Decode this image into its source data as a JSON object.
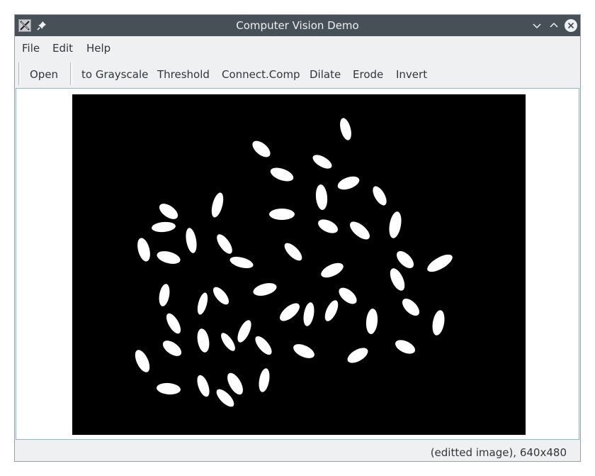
{
  "window": {
    "title": "Computer Vision Demo"
  },
  "menu": {
    "file": "File",
    "edit": "Edit",
    "help": "Help"
  },
  "toolbar": {
    "open": "Open",
    "grayscale": "to Grayscale",
    "threshold": "Threshold",
    "connect": "Connect.Comp",
    "dilate": "Dilate",
    "erode": "Erode",
    "invert": "Invert"
  },
  "status": {
    "text": "(editted image), 640x480"
  },
  "colors": {
    "titlebar": "#475057",
    "window_bg": "#eff0f1",
    "focus_border": "#88b8d8",
    "canvas_bg": "#000000",
    "blob": "#ffffff",
    "close_button": "#eff0f1"
  },
  "icons": [
    "x-app-icon",
    "pin-icon",
    "minimize-icon",
    "maximize-icon",
    "close-icon"
  ]
}
